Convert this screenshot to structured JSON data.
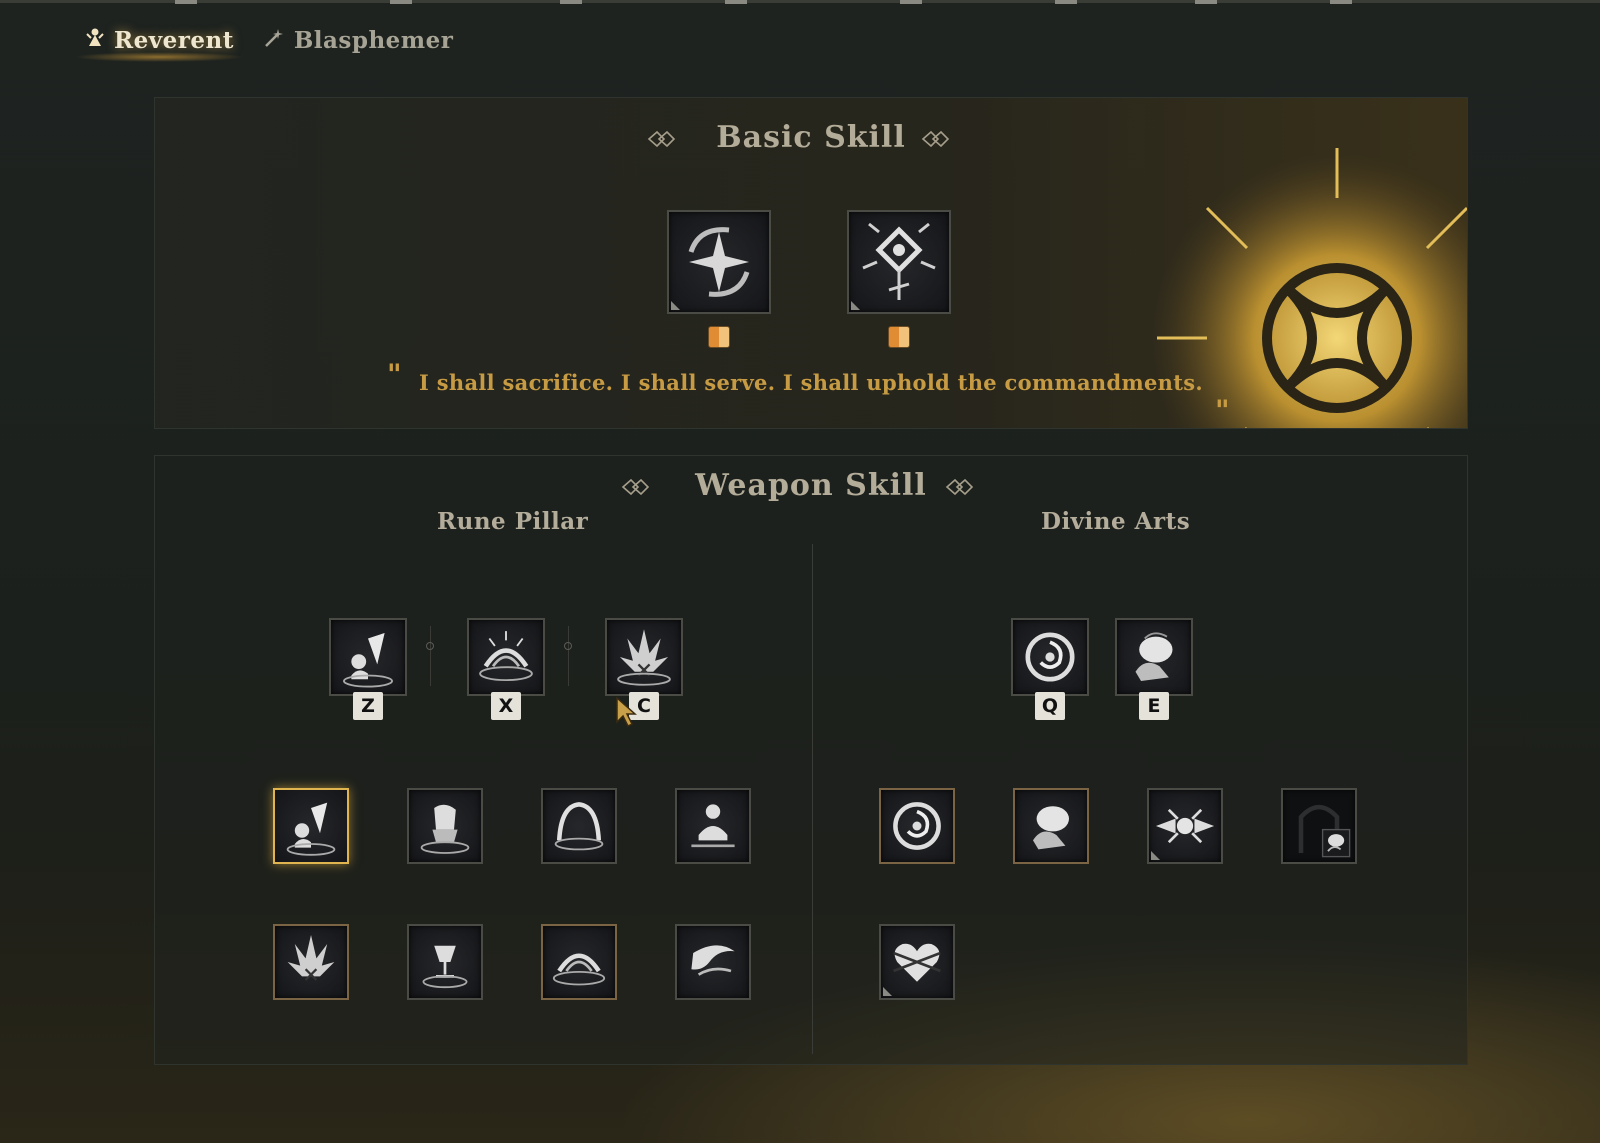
{
  "tabs": [
    {
      "label": "Reverent",
      "active": true,
      "icon": "reverent-icon"
    },
    {
      "label": "Blasphemer",
      "active": false,
      "icon": "blasphemer-icon"
    }
  ],
  "basic": {
    "title": "Basic Skill",
    "skills": [
      {
        "icon": "swirl-star-icon"
      },
      {
        "icon": "thorn-sigil-icon"
      }
    ],
    "quote_open": "\"",
    "quote": "I shall sacrifice. I shall serve. I shall uphold the commandments.",
    "quote_close": "\""
  },
  "weapon": {
    "title": "Weapon Skill",
    "rune_pillar": {
      "title": "Rune Pillar",
      "equipped": [
        {
          "icon": "pillar-strike-icon",
          "key": "Z"
        },
        {
          "icon": "pillar-dome-icon",
          "key": "X"
        },
        {
          "icon": "pillar-burst-icon",
          "key": "C"
        }
      ]
    },
    "divine_arts": {
      "title": "Divine Arts",
      "equipped": [
        {
          "icon": "vortex-icon",
          "key": "Q"
        },
        {
          "icon": "divine-hand-icon",
          "key": "E"
        }
      ]
    }
  },
  "colors": {
    "accent_gold": "#e0b44e",
    "quote_gold": "#c79b43"
  }
}
